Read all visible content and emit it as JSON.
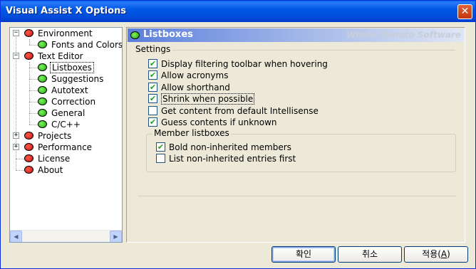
{
  "window": {
    "title": "Visual Assist X Options",
    "close_icon": "✕"
  },
  "tree": {
    "items": [
      {
        "label": "Environment",
        "expander": "−",
        "icon": "tomato-red"
      },
      {
        "label": "Fonts and Colors",
        "icon": "tomato-green"
      },
      {
        "label": "Text Editor",
        "expander": "−",
        "icon": "tomato-red"
      },
      {
        "label": "Listboxes",
        "icon": "tomato-green",
        "selected": true
      },
      {
        "label": "Suggestions",
        "icon": "tomato-green"
      },
      {
        "label": "Autotext",
        "icon": "tomato-green"
      },
      {
        "label": "Correction",
        "icon": "tomato-green"
      },
      {
        "label": "General",
        "icon": "tomato-green"
      },
      {
        "label": "C/C++",
        "icon": "tomato-green"
      },
      {
        "label": "Projects",
        "expander": "+",
        "icon": "tomato-red"
      },
      {
        "label": "Performance",
        "expander": "+",
        "icon": "tomato-red"
      },
      {
        "label": "License",
        "icon": "tomato-red"
      },
      {
        "label": "About",
        "icon": "tomato-red"
      }
    ],
    "scroll_left": "◀",
    "scroll_right": "▶"
  },
  "panel": {
    "title": "Listboxes",
    "brand": "Whole Tomato Software",
    "settings_label": "Settings",
    "options": [
      {
        "label": "Display filtering toolbar when hovering",
        "checked": true
      },
      {
        "label": "Allow acronyms",
        "checked": true
      },
      {
        "label": "Allow shorthand",
        "checked": true
      },
      {
        "label": "Shrink when possible",
        "checked": true,
        "focused": true
      },
      {
        "label": "Get content from default Intellisense",
        "checked": false
      },
      {
        "label": "Guess contents if unknown",
        "checked": true
      }
    ],
    "member_group_label": "Member listboxes",
    "member_options": [
      {
        "label": "Bold non-inherited members",
        "checked": true
      },
      {
        "label": "List non-inherited entries first",
        "checked": false
      }
    ]
  },
  "buttons": {
    "ok": "확인",
    "cancel": "취소",
    "apply_prefix": "적용(",
    "apply_key": "A",
    "apply_suffix": ")"
  },
  "colors": {
    "title_bar": "#0058e6",
    "panel_header": "#5a7edc",
    "check_mark": "#21a121"
  }
}
